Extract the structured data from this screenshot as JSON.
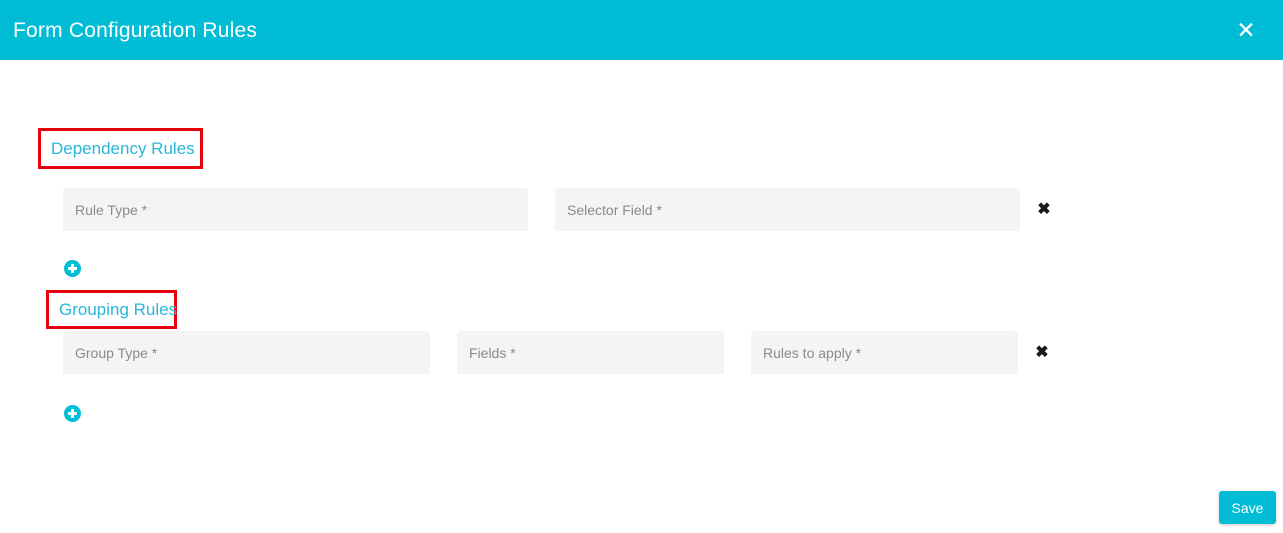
{
  "dialog": {
    "title": "Form Configuration Rules",
    "close_label": "✕",
    "header_color": "#00bcd4"
  },
  "sections": [
    {
      "id": "dependency",
      "heading": "Dependency Rules",
      "heading_color": "#29b6d8",
      "annotation_color": "#e8000d",
      "fields": [
        {
          "placeholder": "Rule Type *",
          "value": ""
        },
        {
          "placeholder": "Selector Field *",
          "value": ""
        }
      ],
      "remove_label": "✖",
      "add_label": "+"
    },
    {
      "id": "grouping",
      "heading": "Grouping Rules",
      "heading_color": "#29b6d8",
      "annotation_color": "#e8000d",
      "fields": [
        {
          "placeholder": "Group Type *",
          "value": ""
        },
        {
          "placeholder": "Fields *",
          "value": ""
        },
        {
          "placeholder": "Rules to apply *",
          "value": ""
        }
      ],
      "remove_label": "✖",
      "add_label": "+"
    }
  ],
  "footer": {
    "save_label": "Save",
    "save_color": "#00bcd4"
  }
}
